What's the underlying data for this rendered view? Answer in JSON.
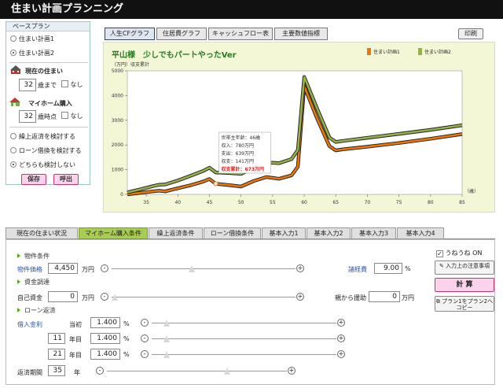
{
  "app": {
    "title": "住まい計画プランニング"
  },
  "left_panel": {
    "header": "ベースプラン",
    "plans": [
      {
        "label": "住まい計画1",
        "selected": false
      },
      {
        "label": "住まい計画2",
        "selected": true
      }
    ],
    "current_home": {
      "title": "現在の住まい",
      "value": "32",
      "unit": "歳まで",
      "none_label": "なし"
    },
    "purchase": {
      "title": "マイホーム購入",
      "value": "32",
      "unit": "歳時点",
      "none_label": "なし"
    },
    "options": [
      {
        "label": "繰上返済を検討する",
        "selected": false
      },
      {
        "label": "ローン借換を検討する",
        "selected": false
      },
      {
        "label": "どちらも検討しない",
        "selected": true
      }
    ],
    "save_label": "保存",
    "load_label": "呼出"
  },
  "top_tabs": [
    {
      "label": "人生CFグラフ",
      "active": true
    },
    {
      "label": "住居費グラフ",
      "active": false
    },
    {
      "label": "キャッシュフロー表",
      "active": false
    },
    {
      "label": "主要数値指標",
      "active": false
    }
  ],
  "print_label": "印刷",
  "chart_data": {
    "type": "line",
    "title": "平山様　少しでもパートやったVer",
    "subtitle": "（万円）収支累計",
    "xlabel": "（歳）",
    "x_ticks": [
      35,
      40,
      45,
      50,
      55,
      60,
      65,
      70,
      75,
      80,
      85
    ],
    "y_ticks": [
      0,
      1000,
      2000,
      3000,
      4000,
      5000
    ],
    "xlim": [
      32,
      85
    ],
    "ylim": [
      0,
      5000
    ],
    "colors": {
      "plan1": "#e8780c",
      "plan2": "#98b04a"
    },
    "series": [
      {
        "name": "住まい計画1",
        "x": [
          32,
          34,
          36,
          37,
          38,
          40,
          42,
          44,
          45,
          46,
          48,
          50,
          52,
          54,
          55,
          56,
          58,
          59,
          60,
          62,
          64,
          65,
          66,
          70,
          75,
          80,
          85
        ],
        "y": [
          0,
          60,
          120,
          150,
          120,
          250,
          370,
          520,
          620,
          430,
          380,
          320,
          540,
          700,
          670,
          630,
          770,
          1120,
          4380,
          3100,
          1950,
          1780,
          1820,
          1930,
          2080,
          2250,
          2440
        ]
      },
      {
        "name": "住まい計画2",
        "x": [
          32,
          34,
          36,
          37,
          38,
          40,
          42,
          44,
          45,
          46,
          48,
          50,
          52,
          54,
          55,
          56,
          58,
          59,
          60,
          62,
          64,
          65,
          66,
          70,
          75,
          80,
          85
        ],
        "y": [
          80,
          200,
          330,
          390,
          400,
          560,
          750,
          950,
          1080,
          890,
          870,
          830,
          1070,
          1270,
          1280,
          1260,
          1430,
          1800,
          4750,
          3500,
          2300,
          2120,
          2160,
          2290,
          2450,
          2610,
          2800
        ]
      }
    ],
    "tooltip": {
      "lines": [
        "世帯主年齢：46歳",
        "収入：780万円",
        "支出：639万円",
        "収支：141万円"
      ],
      "highlight": "収支累計：673万円"
    }
  },
  "bottom_tabs": [
    {
      "label": "現在の住まい状況",
      "active": false
    },
    {
      "label": "マイホーム購入条件",
      "active": true
    },
    {
      "label": "繰上返済条件",
      "active": false
    },
    {
      "label": "ローン借換条件",
      "active": false
    },
    {
      "label": "基本入力1",
      "active": false
    },
    {
      "label": "基本入力2",
      "active": false
    },
    {
      "label": "基本入力3",
      "active": false
    },
    {
      "label": "基本入力4",
      "active": false
    }
  ],
  "form": {
    "property_section": "物件条件",
    "property_price_label": "物件価格",
    "property_price": "4,450",
    "property_unit": "万円",
    "misc_cost_label": "諸経費",
    "misc_cost": "9.00",
    "misc_unit": "%",
    "funding_section": "資金調達",
    "own_funds_label": "自己資金",
    "own_funds": "0",
    "own_funds_unit": "万円",
    "parents_label": "親から援助",
    "parents": "0",
    "parents_unit": "万円",
    "loan_section": "ローン返済",
    "rate_label": "借入金利",
    "rate_rows": [
      {
        "year_prefix": "当初",
        "year": "",
        "year_suffix": "",
        "rate": "1.400",
        "unit": "%"
      },
      {
        "year_prefix": "",
        "year": "11",
        "year_suffix": "年目",
        "rate": "1.400",
        "unit": "%"
      },
      {
        "year_prefix": "",
        "year": "21",
        "year_suffix": "年目",
        "rate": "1.400",
        "unit": "%"
      }
    ],
    "period_label": "返済期間",
    "period": "35",
    "period_unit": "年"
  },
  "side": {
    "tips_label": "うねうね ON",
    "notes_label": "入力上の注意事項",
    "calc_label": "計 算",
    "copy_label": "プラン1をプラン2へコピー"
  }
}
